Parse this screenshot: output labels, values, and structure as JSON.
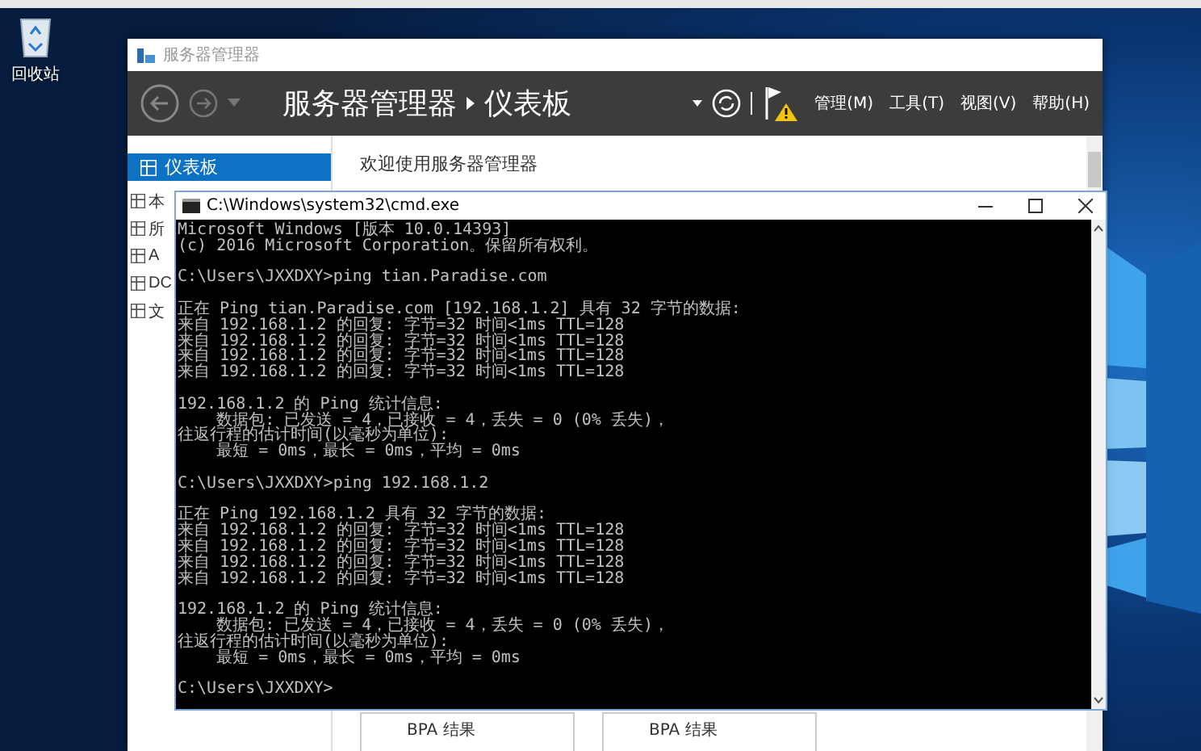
{
  "desktop": {
    "icons": [
      {
        "label": "回收站"
      }
    ]
  },
  "server_manager": {
    "window_title": "服务器管理器",
    "breadcrumb": [
      "服务器管理器",
      "仪表板"
    ],
    "menu": [
      "管理(M)",
      "工具(T)",
      "视图(V)",
      "帮助(H)"
    ],
    "sidebar": [
      {
        "label": "仪表板",
        "selected": true
      },
      {
        "label": "本",
        "selected": false
      },
      {
        "label": "所",
        "selected": false
      },
      {
        "label": "A",
        "selected": false
      },
      {
        "label": "DC",
        "selected": false
      },
      {
        "label": "文",
        "selected": false
      }
    ],
    "welcome": "欢迎使用服务器管理器",
    "tiles": [
      {
        "label": "BPA 结果"
      },
      {
        "label": "BPA 结果"
      }
    ]
  },
  "cmd": {
    "title": "C:\\Windows\\system32\\cmd.exe",
    "blocks": [
      [
        "Microsoft Windows [版本 10.0.14393]",
        "(c) 2016 Microsoft Corporation。保留所有权利。"
      ],
      [
        "C:\\Users\\JXXDXY>ping tian.Paradise.com"
      ],
      [
        "正在 Ping tian.Paradise.com [192.168.1.2] 具有 32 字节的数据:",
        "来自 192.168.1.2 的回复: 字节=32 时间<1ms TTL=128",
        "来自 192.168.1.2 的回复: 字节=32 时间<1ms TTL=128",
        "来自 192.168.1.2 的回复: 字节=32 时间<1ms TTL=128",
        "来自 192.168.1.2 的回复: 字节=32 时间<1ms TTL=128"
      ],
      [
        "192.168.1.2 的 Ping 统计信息:",
        "    数据包: 已发送 = 4，已接收 = 4，丢失 = 0 (0% 丢失)，",
        "往返行程的估计时间(以毫秒为单位):",
        "    最短 = 0ms，最长 = 0ms，平均 = 0ms"
      ],
      [
        "C:\\Users\\JXXDXY>ping 192.168.1.2"
      ],
      [
        "正在 Ping 192.168.1.2 具有 32 字节的数据:",
        "来自 192.168.1.2 的回复: 字节=32 时间<1ms TTL=128",
        "来自 192.168.1.2 的回复: 字节=32 时间<1ms TTL=128",
        "来自 192.168.1.2 的回复: 字节=32 时间<1ms TTL=128",
        "来自 192.168.1.2 的回复: 字节=32 时间<1ms TTL=128"
      ],
      [
        "192.168.1.2 的 Ping 统计信息:",
        "    数据包: 已发送 = 4，已接收 = 4，丢失 = 0 (0% 丢失)，",
        "往返行程的估计时间(以毫秒为单位):",
        "    最短 = 0ms，最长 = 0ms，平均 = 0ms"
      ],
      [
        "C:\\Users\\JXXDXY>"
      ]
    ]
  }
}
